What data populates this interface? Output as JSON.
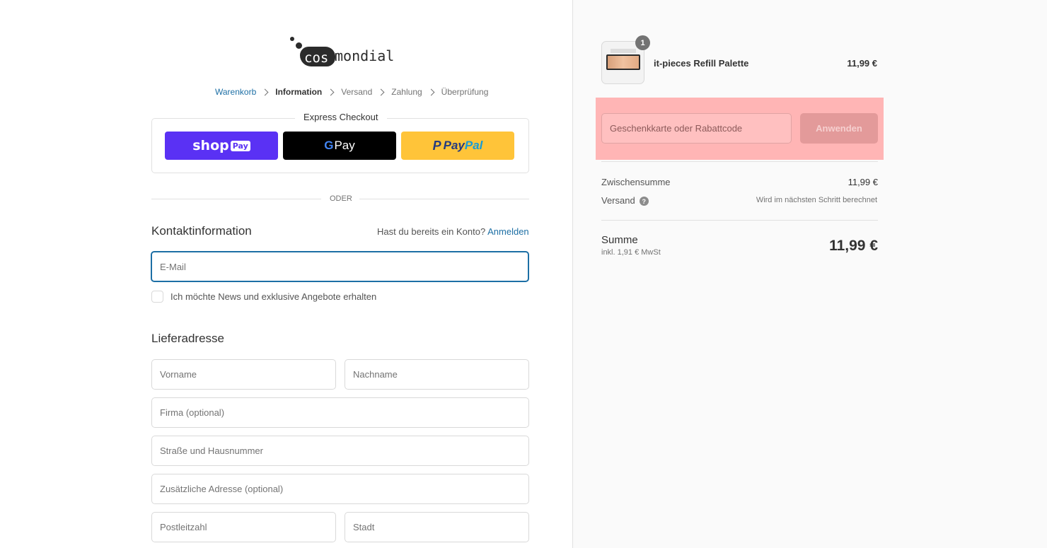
{
  "logo": {
    "part1": "cos",
    "part2": "mondial"
  },
  "breadcrumb": [
    "Warenkorb",
    "Information",
    "Versand",
    "Zahlung",
    "Überprüfung"
  ],
  "express": {
    "title": "Express Checkout",
    "shop_pay": {
      "text": "shop",
      "badge": "Pay"
    },
    "google_pay": {
      "g": "G",
      "text": "Pay"
    },
    "paypal": {
      "p": "P",
      "pay": "Pay",
      "pal": "Pal"
    }
  },
  "divider_text": "ODER",
  "contact": {
    "title": "Kontaktinformation",
    "account_question": "Hast du bereits ein Konto?",
    "login_link": "Anmelden",
    "email_placeholder": "E-Mail",
    "newsletter_label": "Ich möchte News und exklusive Angebote erhalten"
  },
  "shipping": {
    "title": "Lieferadresse",
    "first_name": "Vorname",
    "last_name": "Nachname",
    "company": "Firma (optional)",
    "street": "Straße und Hausnummer",
    "address2": "Zusätzliche Adresse (optional)",
    "zip": "Postleitzahl",
    "city": "Stadt"
  },
  "cart": {
    "item": {
      "name": "it-pieces Refill Palette",
      "price": "11,99 €",
      "quantity": "1"
    },
    "discount_placeholder": "Geschenkkarte oder Rabattcode",
    "apply_label": "Anwenden",
    "subtotal_label": "Zwischensumme",
    "subtotal_value": "11,99 €",
    "shipping_label": "Versand",
    "shipping_value": "Wird im nächsten Schritt berechnet",
    "total_label": "Summe",
    "tax_note": "inkl. 1,91 € MwSt",
    "total_value": "11,99 €"
  },
  "colors": {
    "link": "#1d6fa5",
    "shop_pay": "#5a31f4",
    "paypal": "#ffc439",
    "highlight": "#ffb5b5"
  }
}
